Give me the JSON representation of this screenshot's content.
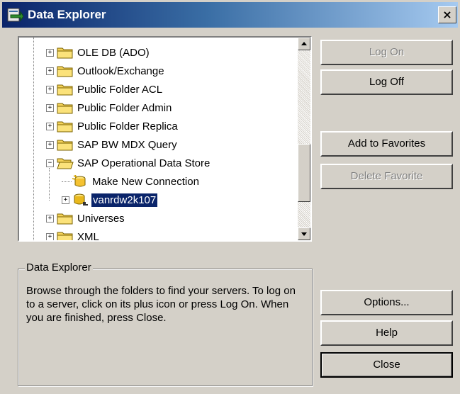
{
  "window": {
    "title": "Data Explorer",
    "close_glyph": "×"
  },
  "tree": {
    "items": [
      {
        "label": "OLE DB (ADO)",
        "expander": "+",
        "icon": "folder-icon"
      },
      {
        "label": "Outlook/Exchange",
        "expander": "+",
        "icon": "folder-icon"
      },
      {
        "label": "Public Folder ACL",
        "expander": "+",
        "icon": "folder-icon"
      },
      {
        "label": "Public Folder Admin",
        "expander": "+",
        "icon": "folder-icon"
      },
      {
        "label": "Public Folder Replica",
        "expander": "+",
        "icon": "folder-icon"
      },
      {
        "label": "SAP BW MDX Query",
        "expander": "+",
        "icon": "folder-icon"
      },
      {
        "label": "SAP Operational Data Store",
        "expander": "−",
        "icon": "open-folder-icon"
      },
      {
        "label": "Make New Connection",
        "expander": "",
        "icon": "new-connection-icon"
      },
      {
        "label": "vanrdw2k107",
        "expander": "+",
        "icon": "server-icon",
        "selected": true
      },
      {
        "label": "Universes",
        "expander": "+",
        "icon": "folder-icon"
      },
      {
        "label": "XML",
        "expander": "+",
        "icon": "folder-icon"
      }
    ]
  },
  "buttons": {
    "log_on": "Log On",
    "log_off": "Log Off",
    "add_favorites": "Add to Favorites",
    "delete_favorite": "Delete Favorite",
    "options": "Options...",
    "help": "Help",
    "close": "Close"
  },
  "groupbox": {
    "title": "Data Explorer",
    "text": "Browse through the folders to find your servers.  To log on to a server, click on its plus icon or press Log On.  When you are finished, press Close."
  },
  "colors": {
    "titlebar_start": "#0a246a",
    "titlebar_end": "#a6caf0",
    "face": "#d4d0c8",
    "selection": "#0a246a"
  }
}
